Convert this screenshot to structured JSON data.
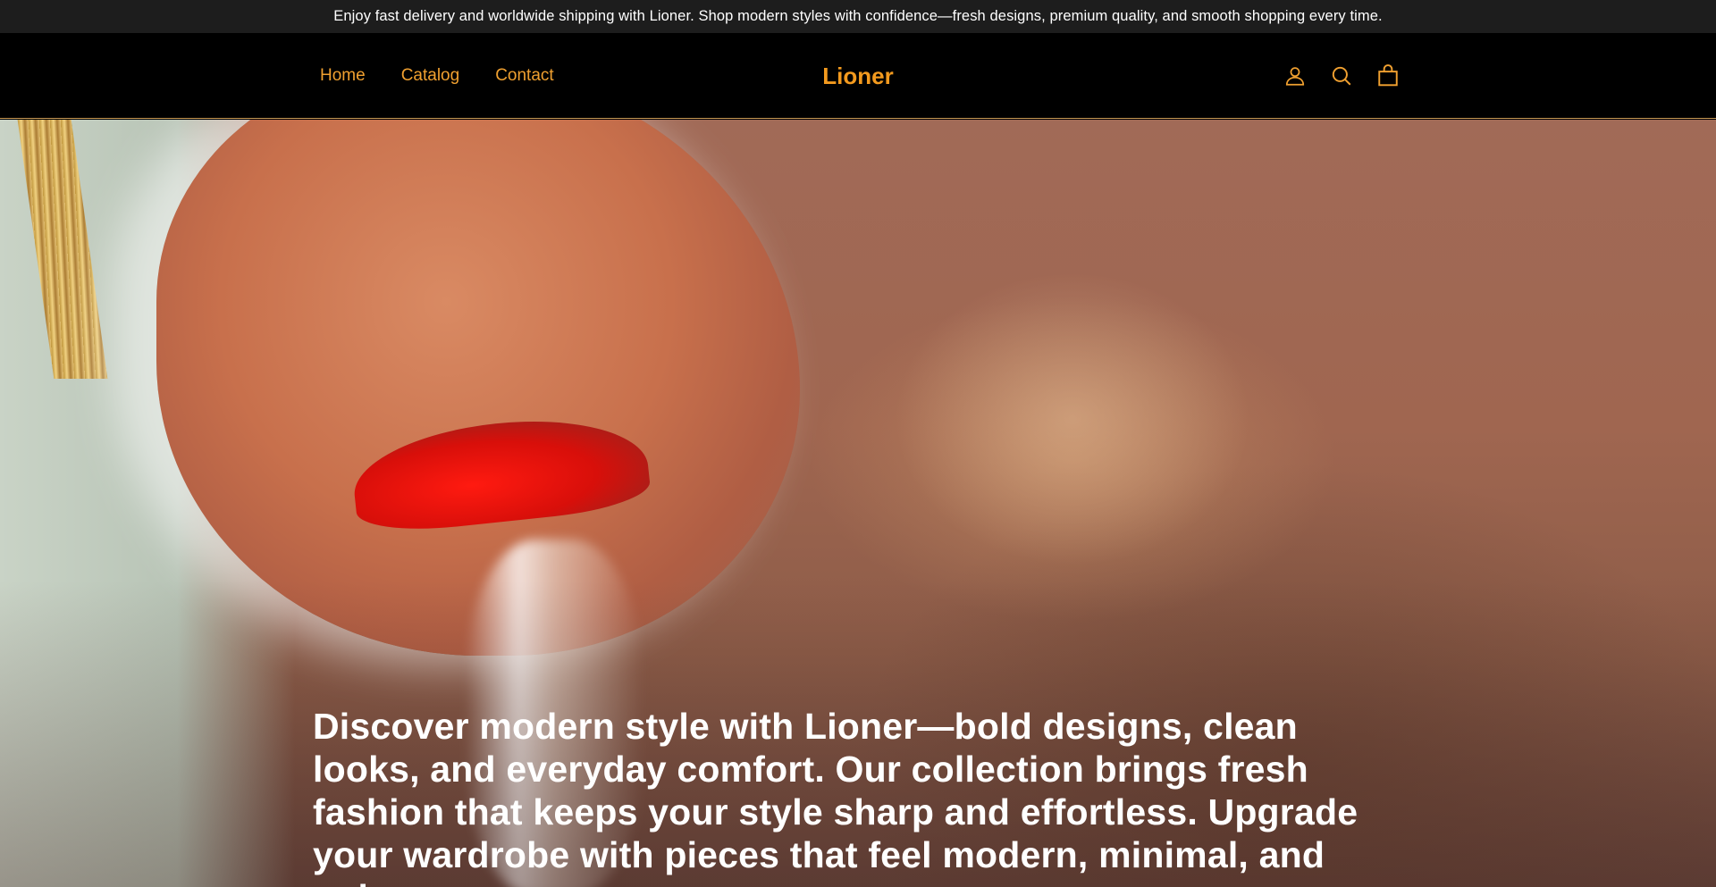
{
  "announcement": {
    "text": "Enjoy fast delivery and worldwide shipping with Lioner. Shop modern styles with confidence—fresh designs, premium quality, and smooth shopping every time."
  },
  "header": {
    "nav": [
      {
        "label": "Home"
      },
      {
        "label": "Catalog"
      },
      {
        "label": "Contact"
      }
    ],
    "logo": "Lioner",
    "icons": [
      "account-icon",
      "search-icon",
      "cart-icon"
    ]
  },
  "hero": {
    "image_alt": "Close-up of a face with a bright red nostril highlight",
    "heading": "Discover modern style with Lioner—bold designs, clean looks, and everyday comfort. Our collection brings fresh fashion that keeps your style sharp and effortless. Upgrade your wardrobe with pieces that feel modern, minimal, and unique."
  },
  "colors": {
    "accent": "#f39a1e",
    "nav_text": "#f0a030",
    "announcement_bg": "#1d1d1d",
    "header_bg": "#000000",
    "header_border": "#c99a55"
  }
}
